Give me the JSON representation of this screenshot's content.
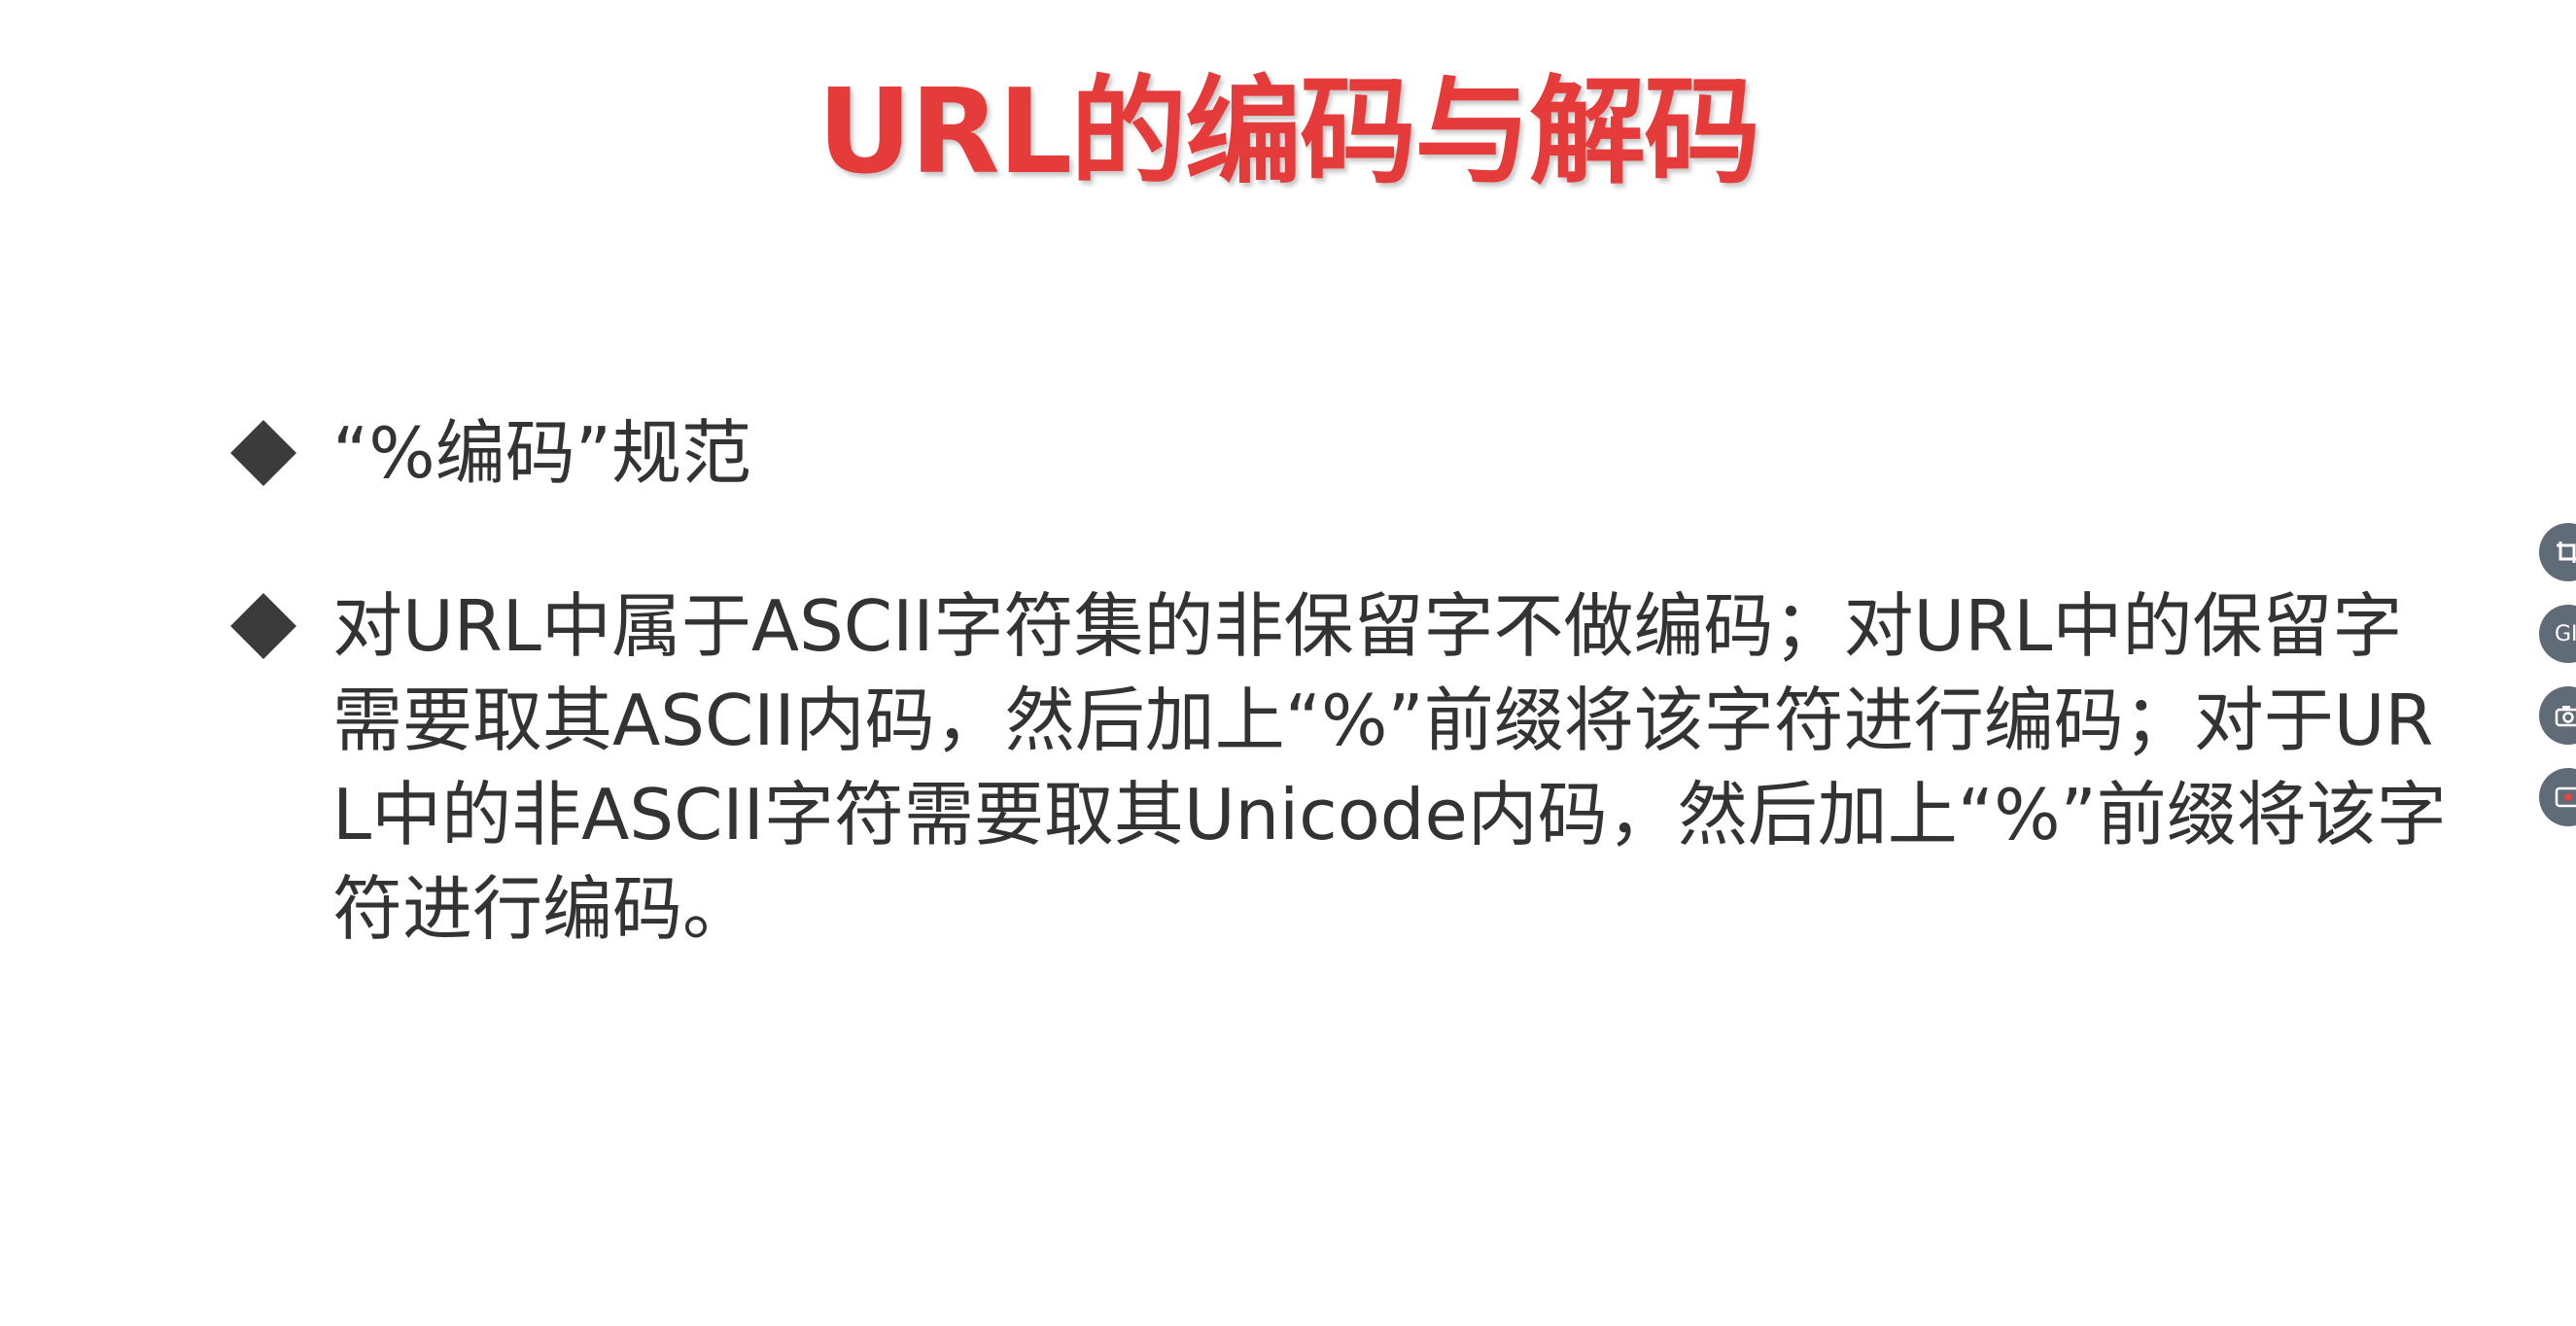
{
  "slide": {
    "title": "URL的编码与解码",
    "bullets": [
      "“%编码”规范",
      "对URL中属于ASCII字符集的非保留字不做编码；对URL中的保留字需要取其ASCII内码，然后加上“%”前缀将该字符进行编码；对于URL中的非ASCII字符需要取其Unicode内码，然后加上“%”前缀将该字符进行编码。"
    ]
  },
  "toolbar": {
    "buttons": [
      {
        "icon": "crop-icon"
      },
      {
        "icon": "gif-icon",
        "label": "GI"
      },
      {
        "icon": "camera-icon"
      },
      {
        "icon": "record-icon"
      }
    ]
  }
}
